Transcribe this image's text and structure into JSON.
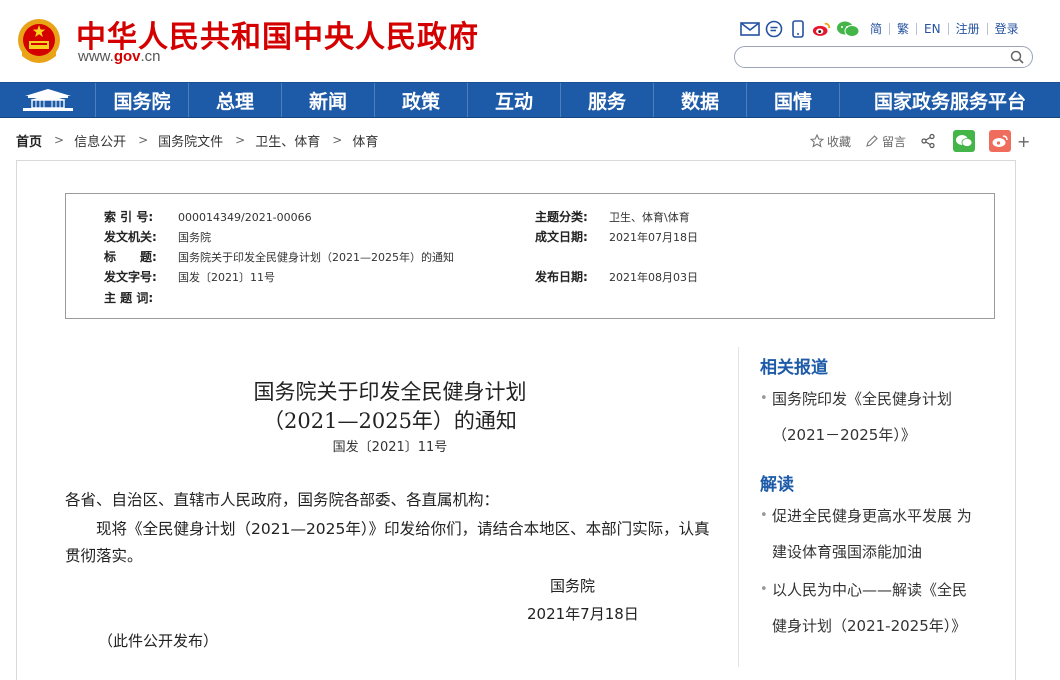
{
  "header": {
    "site_title": "中华人民共和国中央人民政府",
    "url_prefix": "www.",
    "url_gov": "gov",
    "url_suffix": ".cn",
    "tools": [
      "mail-icon",
      "comment-icon",
      "mobile-icon",
      "weibo-icon",
      "wechat-icon"
    ],
    "lang_links": [
      "简",
      "繁",
      "EN",
      "注册",
      "登录"
    ],
    "search_placeholder": ""
  },
  "nav": {
    "items": [
      "国务院",
      "总理",
      "新闻",
      "政策",
      "互动",
      "服务",
      "数据",
      "国情",
      "国家政务服务平台"
    ]
  },
  "breadcrumb": {
    "items": [
      "首页",
      "信息公开",
      "国务院文件",
      "卫生、体育",
      "体育"
    ]
  },
  "share": {
    "favorite": "收藏",
    "comment": "留言"
  },
  "meta": {
    "index_no_label": "索 引 号:",
    "index_no": "000014349/2021-00066",
    "category_label": "主题分类:",
    "category": "卫生、体育\\体育",
    "issuer_label": "发文机关:",
    "issuer": "国务院",
    "written_label": "成文日期:",
    "written": "2021年07月18日",
    "title_label": "标　　题:",
    "title": "国务院关于印发全民健身计划（2021—2025年）的通知",
    "docno_label": "发文字号:",
    "docno": "国发〔2021〕11号",
    "published_label": "发布日期:",
    "published": "2021年08月03日",
    "keywords_label": "主 题 词:",
    "keywords": ""
  },
  "article": {
    "title_line1": "国务院关于印发全民健身计划",
    "title_line2": "（2021—2025年）的通知",
    "docno": "国发〔2021〕11号",
    "salutation": "各省、自治区、直辖市人民政府，国务院各部委、各直属机构：",
    "body": "　　现将《全民健身计划（2021—2025年）》印发给你们，请结合本地区、本部门实际，认真贯彻落实。",
    "signer": "国务院",
    "date": "2021年7月18日",
    "note": "（此件公开发布）"
  },
  "sidebar": {
    "related_title": "相关报道",
    "related": [
      {
        "line1": "国务院印发《全民健身计划",
        "line2": "（2021－2025年）》"
      }
    ],
    "interpret_title": "解读",
    "interpret": [
      {
        "line1": "促进全民健身更高水平发展 为",
        "line2": "建设体育强国添能加油"
      },
      {
        "line1": "以人民为中心——解读《全民",
        "line2": "健身计划（2021-2025年）》"
      }
    ]
  },
  "colors": {
    "brand_red": "#d40000",
    "nav_blue": "#1d5aa8",
    "link_blue": "#2553a0"
  }
}
